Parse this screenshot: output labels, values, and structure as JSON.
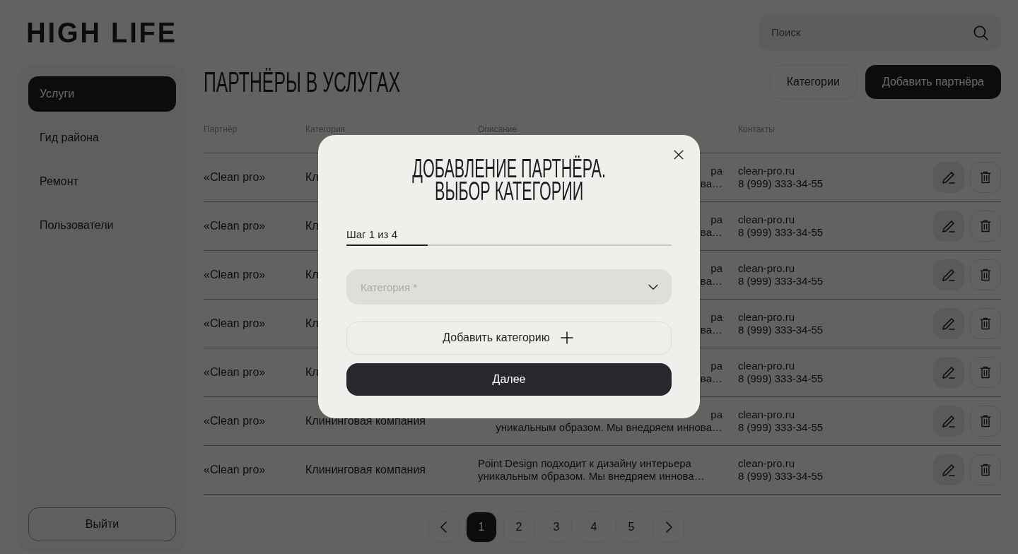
{
  "logo": "HIGH LIFE",
  "search": {
    "placeholder": "Поиск"
  },
  "sidebar": {
    "items": [
      {
        "label": "Услуги",
        "selected": true
      },
      {
        "label": "Гид района",
        "selected": false
      },
      {
        "label": "Ремонт",
        "selected": false
      },
      {
        "label": "Пользователи",
        "selected": false
      }
    ],
    "logout": "Выйти"
  },
  "page": {
    "title": "ПАРТНЁРЫ В УСЛУГАХ",
    "buttons": [
      {
        "label": "Категории",
        "kind": "outline"
      },
      {
        "label": "Добавить партнёра",
        "kind": "primary"
      }
    ]
  },
  "table": {
    "columns": [
      "Партнёр",
      "Категория",
      "Описание",
      "Контакты"
    ],
    "rows": [
      {
        "kind": "covered",
        "partner": "«Clean pro»",
        "category": "Кл",
        "description": [
          "ра",
          "ва…"
        ],
        "site": "clean-pro.ru",
        "phone": "8 (999) 333-34-55"
      },
      {
        "kind": "covered",
        "partner": "«Clean pro»",
        "category": "Кл",
        "description": [
          "ра",
          "ва…"
        ],
        "site": "clean-pro.ru",
        "phone": "8 (999) 333-34-55"
      },
      {
        "kind": "covered",
        "partner": "«Clean pro»",
        "category": "Кл",
        "description": [
          "ра",
          "ва…"
        ],
        "site": "clean-pro.ru",
        "phone": "8 (999) 333-34-55"
      },
      {
        "kind": "covered",
        "partner": "«Clean pro»",
        "category": "Кл",
        "description": [
          "ра",
          "ва…"
        ],
        "site": "clean-pro.ru",
        "phone": "8 (999) 333-34-55"
      },
      {
        "kind": "covered",
        "partner": "«Clean pro»",
        "category": "Кл",
        "description": [
          "ра",
          "ва…"
        ],
        "site": "clean-pro.ru",
        "phone": "8 (999) 333-34-55"
      },
      {
        "kind": "covered",
        "partner": "«Clean pro»",
        "category": "Клининговая компания",
        "description": [
          "ра",
          "уникальным образом.  Мы внедряем иннова…"
        ],
        "site": "clean-pro.ru",
        "phone": "8 (999) 333-34-55"
      },
      {
        "kind": "plain",
        "partner": "«Clean pro»",
        "category": "Клининговая компания",
        "description": [
          "Point Design подходит к дизайну интерьера",
          "уникальным образом.  Мы внедряем иннова…"
        ],
        "site": "clean-pro.ru",
        "phone": "8 (999) 333-34-55"
      }
    ]
  },
  "pagination": {
    "pages": [
      {
        "label": "1",
        "selected": true
      },
      {
        "label": "2",
        "selected": false
      },
      {
        "label": "3",
        "selected": false
      },
      {
        "label": "4",
        "selected": false
      },
      {
        "label": "5",
        "selected": false
      }
    ]
  },
  "modal": {
    "title": "ДОБАВЛЕНИЕ ПАРТНЁРА.\nВЫБОР КАТЕГОРИИ",
    "step": {
      "label": "Шаг 1 из 4",
      "level": 0.25
    },
    "select": {
      "placeholder": "Категория *"
    },
    "add_button": "Добавить категорию",
    "next_button": "Далее"
  }
}
